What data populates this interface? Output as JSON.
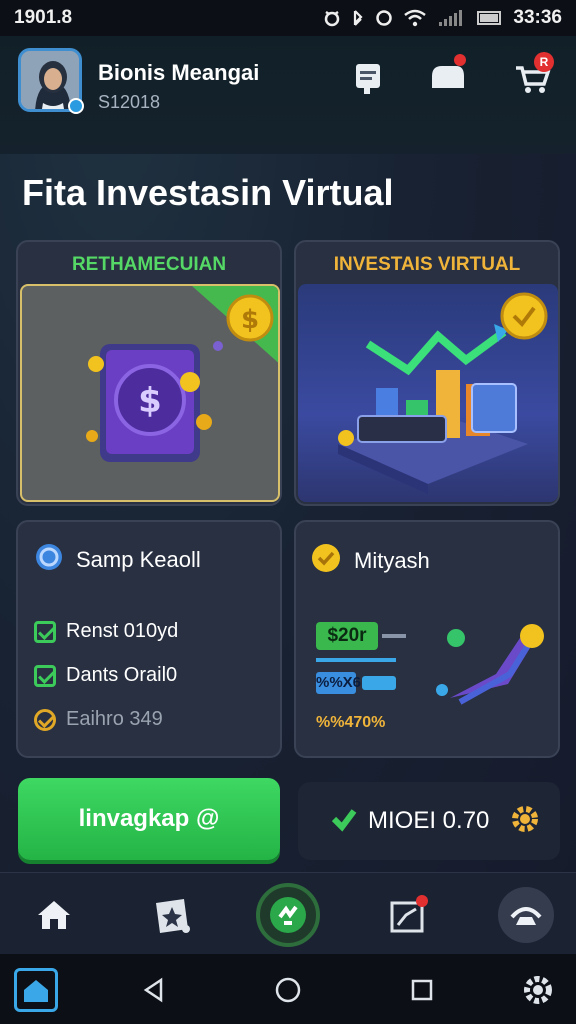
{
  "status_bar": {
    "time_left": "1901.8",
    "time_right": "33:36"
  },
  "profile": {
    "name": "Bionis Meangai",
    "id": "S12018"
  },
  "page_title": "Fita Investasin Virtual",
  "cards": {
    "left_feature": {
      "title": "RETHAMECUIAN",
      "title_color": "#55d865"
    },
    "right_feature": {
      "title": "INVESTAIS VIRTUAL",
      "title_color": "#f0b43a"
    },
    "left_info": {
      "title": "Samp Keaoll",
      "items": [
        {
          "label": "Renst 010yd",
          "icon": "check-icon"
        },
        {
          "label": "Dants Orail0",
          "icon": "check-icon"
        },
        {
          "label": "Eaihro 349",
          "icon": "coin-check-icon"
        }
      ]
    },
    "right_info": {
      "title": "Mityash",
      "price_tag": "$20r",
      "mini_tag": "%%X6",
      "footer_label": "%%470%"
    }
  },
  "cta": {
    "label": "linvagkap @"
  },
  "balance": {
    "label": "MIOEI 0.70"
  },
  "colors": {
    "accent_green": "#3ed862",
    "accent_gold": "#f0b43a",
    "badge_red": "#e23030"
  },
  "nav": {
    "items": [
      {
        "name": "home",
        "icon": "home-icon"
      },
      {
        "name": "star",
        "icon": "star-card-icon"
      },
      {
        "name": "center",
        "icon": "refresh-icon"
      },
      {
        "name": "chart",
        "icon": "chart-icon"
      },
      {
        "name": "profile",
        "icon": "user-icon"
      }
    ]
  }
}
